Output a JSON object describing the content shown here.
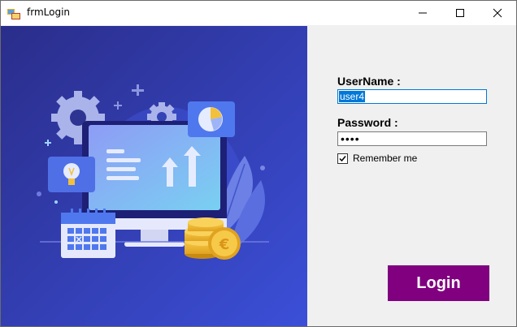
{
  "window": {
    "title": "frmLogin"
  },
  "form": {
    "username_label": "UserName :",
    "username_value": "user4",
    "password_label": "Password :",
    "password_masked": "••••",
    "remember_label": "Remember me",
    "remember_checked": true,
    "login_label": "Login"
  },
  "colors": {
    "illustration_bg_dark": "#2b2f8f",
    "illustration_bg_light": "#3a4bd6",
    "login_button": "#800080",
    "selection": "#0078d7"
  }
}
